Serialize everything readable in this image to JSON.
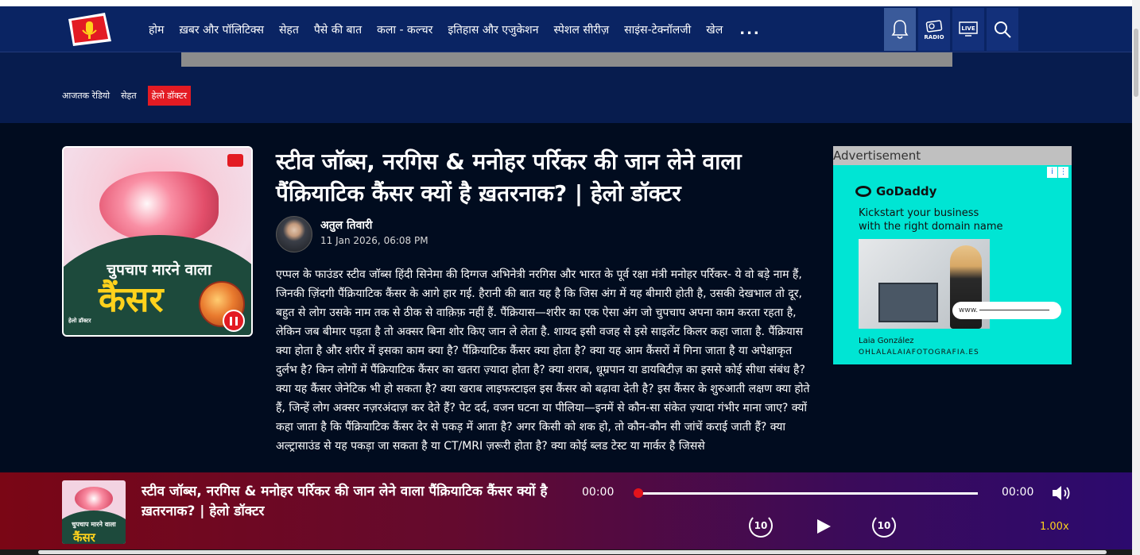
{
  "nav": {
    "items": [
      "होम",
      "ख़बर और पॉलिटिक्स",
      "सेहत",
      "पैसे की बात",
      "कला - कल्चर",
      "इतिहास और एजुकेशन",
      "स्पेशल सीरीज़",
      "साइंस-टेक्नॉलजी",
      "खेल"
    ],
    "more": "...",
    "radio_label": "RADIO",
    "live_label": "LIVE"
  },
  "breadcrumb": [
    "आजतक रेडियो",
    "सेहत",
    "हेलो डॉक्टर"
  ],
  "cover": {
    "line1": "चुपचाप मारने वाला",
    "line2": "कैंसर",
    "mini_logo": "हेलो डॉक्टर"
  },
  "article": {
    "title": "स्टीव जॉब्स, नरगिस & मनोहर पर्रिकर की जान लेने वाला पैंक्रियाटिक कैंसर क्यों है ख़तरनाक? | हेलो डॉक्टर",
    "author": "अतुल तिवारी",
    "date": "11 Jan 2026, 06:08 PM",
    "body": "एप्पल के फाउंडर स्टीव जॉब्स हिंदी सिनेमा की दिग्गज अभिनेत्री नरगिस और भारत के पूर्व रक्षा मंत्री मनोहर पर्रिकर- ये वो बड़े नाम हैं, जिनकी ज़िंदगी पैंक्रियाटिक कैंसर के आगे हार गई. हैरानी की बात यह है कि जिस अंग में यह बीमारी होती है, उसकी देखभाल तो दूर, बहुत से लोग उसके नाम तक से ठीक से वाक़िफ़ नहीं हैं. पैंक्रियास—शरीर का एक ऐसा अंग जो चुपचाप अपना काम करता रहता है, लेकिन जब बीमार पड़ता है तो अक्सर बिना शोर किए जान ले लेता है. शायद इसी वजह से इसे साइलेंट किलर कहा जाता है. पैंक्रियास क्या होता है और शरीर में इसका काम क्या है? पैंक्रियाटिक कैंसर क्या होता है? क्या यह आम कैंसरों में गिना जाता है या अपेक्षाकृत दुर्लभ है? किन लोगों में पैंक्रियाटिक कैंसर का खतरा ज़्यादा होता है? क्या शराब, धूम्रपान या डायबिटीज़ का इससे कोई सीधा संबंध है? क्या यह कैंसर जेनेटिक भी हो सकता है? क्या खराब लाइफस्टाइल इस कैंसर को बढ़ावा देती है? इस कैंसर के शुरुआती लक्षण क्या होते हैं, जिन्हें लोग अक्सर नज़रअंदाज़ कर देते हैं? पेट दर्द, वजन घटना या पीलिया—इनमें से कौन-सा संकेत ज़्यादा गंभीर माना जाए? क्यों कहा जाता है कि पैंक्रियाटिक कैंसर देर से पकड़ में आता है? अगर किसी को शक हो, तो कौन-कौन सी जांचें कराई जाती हैं? क्या अल्ट्रासाउंड से यह पकड़ा जा सकता है या CT/MRI ज़रूरी होता है? क्या कोई ब्लड टेस्ट या मार्कर है जिससे"
  },
  "ad": {
    "label": "Advertisement",
    "brand": "GoDaddy",
    "copy_line1": "Kickstart your business",
    "copy_line2": "with the right domain name",
    "field_text": "www.",
    "credit_name": "Laia González",
    "credit_site": "OHLALALAIAFOTOGRAFIA.ES"
  },
  "player": {
    "title": "स्टीव जॉब्स, नरगिस & मनोहर पर्रिकर की जान लेने वाला पैंक्रियाटिक कैंसर क्यों है ख़तरनाक? | हेलो डॉक्टर",
    "time_current": "00:00",
    "time_total": "00:00",
    "skip_back": "10",
    "skip_forward": "10",
    "speed": "1.00x",
    "progress": 0,
    "thumb_line1": "चुपचाप मारने वाला",
    "thumb_line2": "कैंसर"
  },
  "colors": {
    "nav_bg": "#0a2463",
    "page_bg": "#010c1f",
    "accent_red": "#e31b23",
    "speed_yellow": "#ffd21c"
  }
}
